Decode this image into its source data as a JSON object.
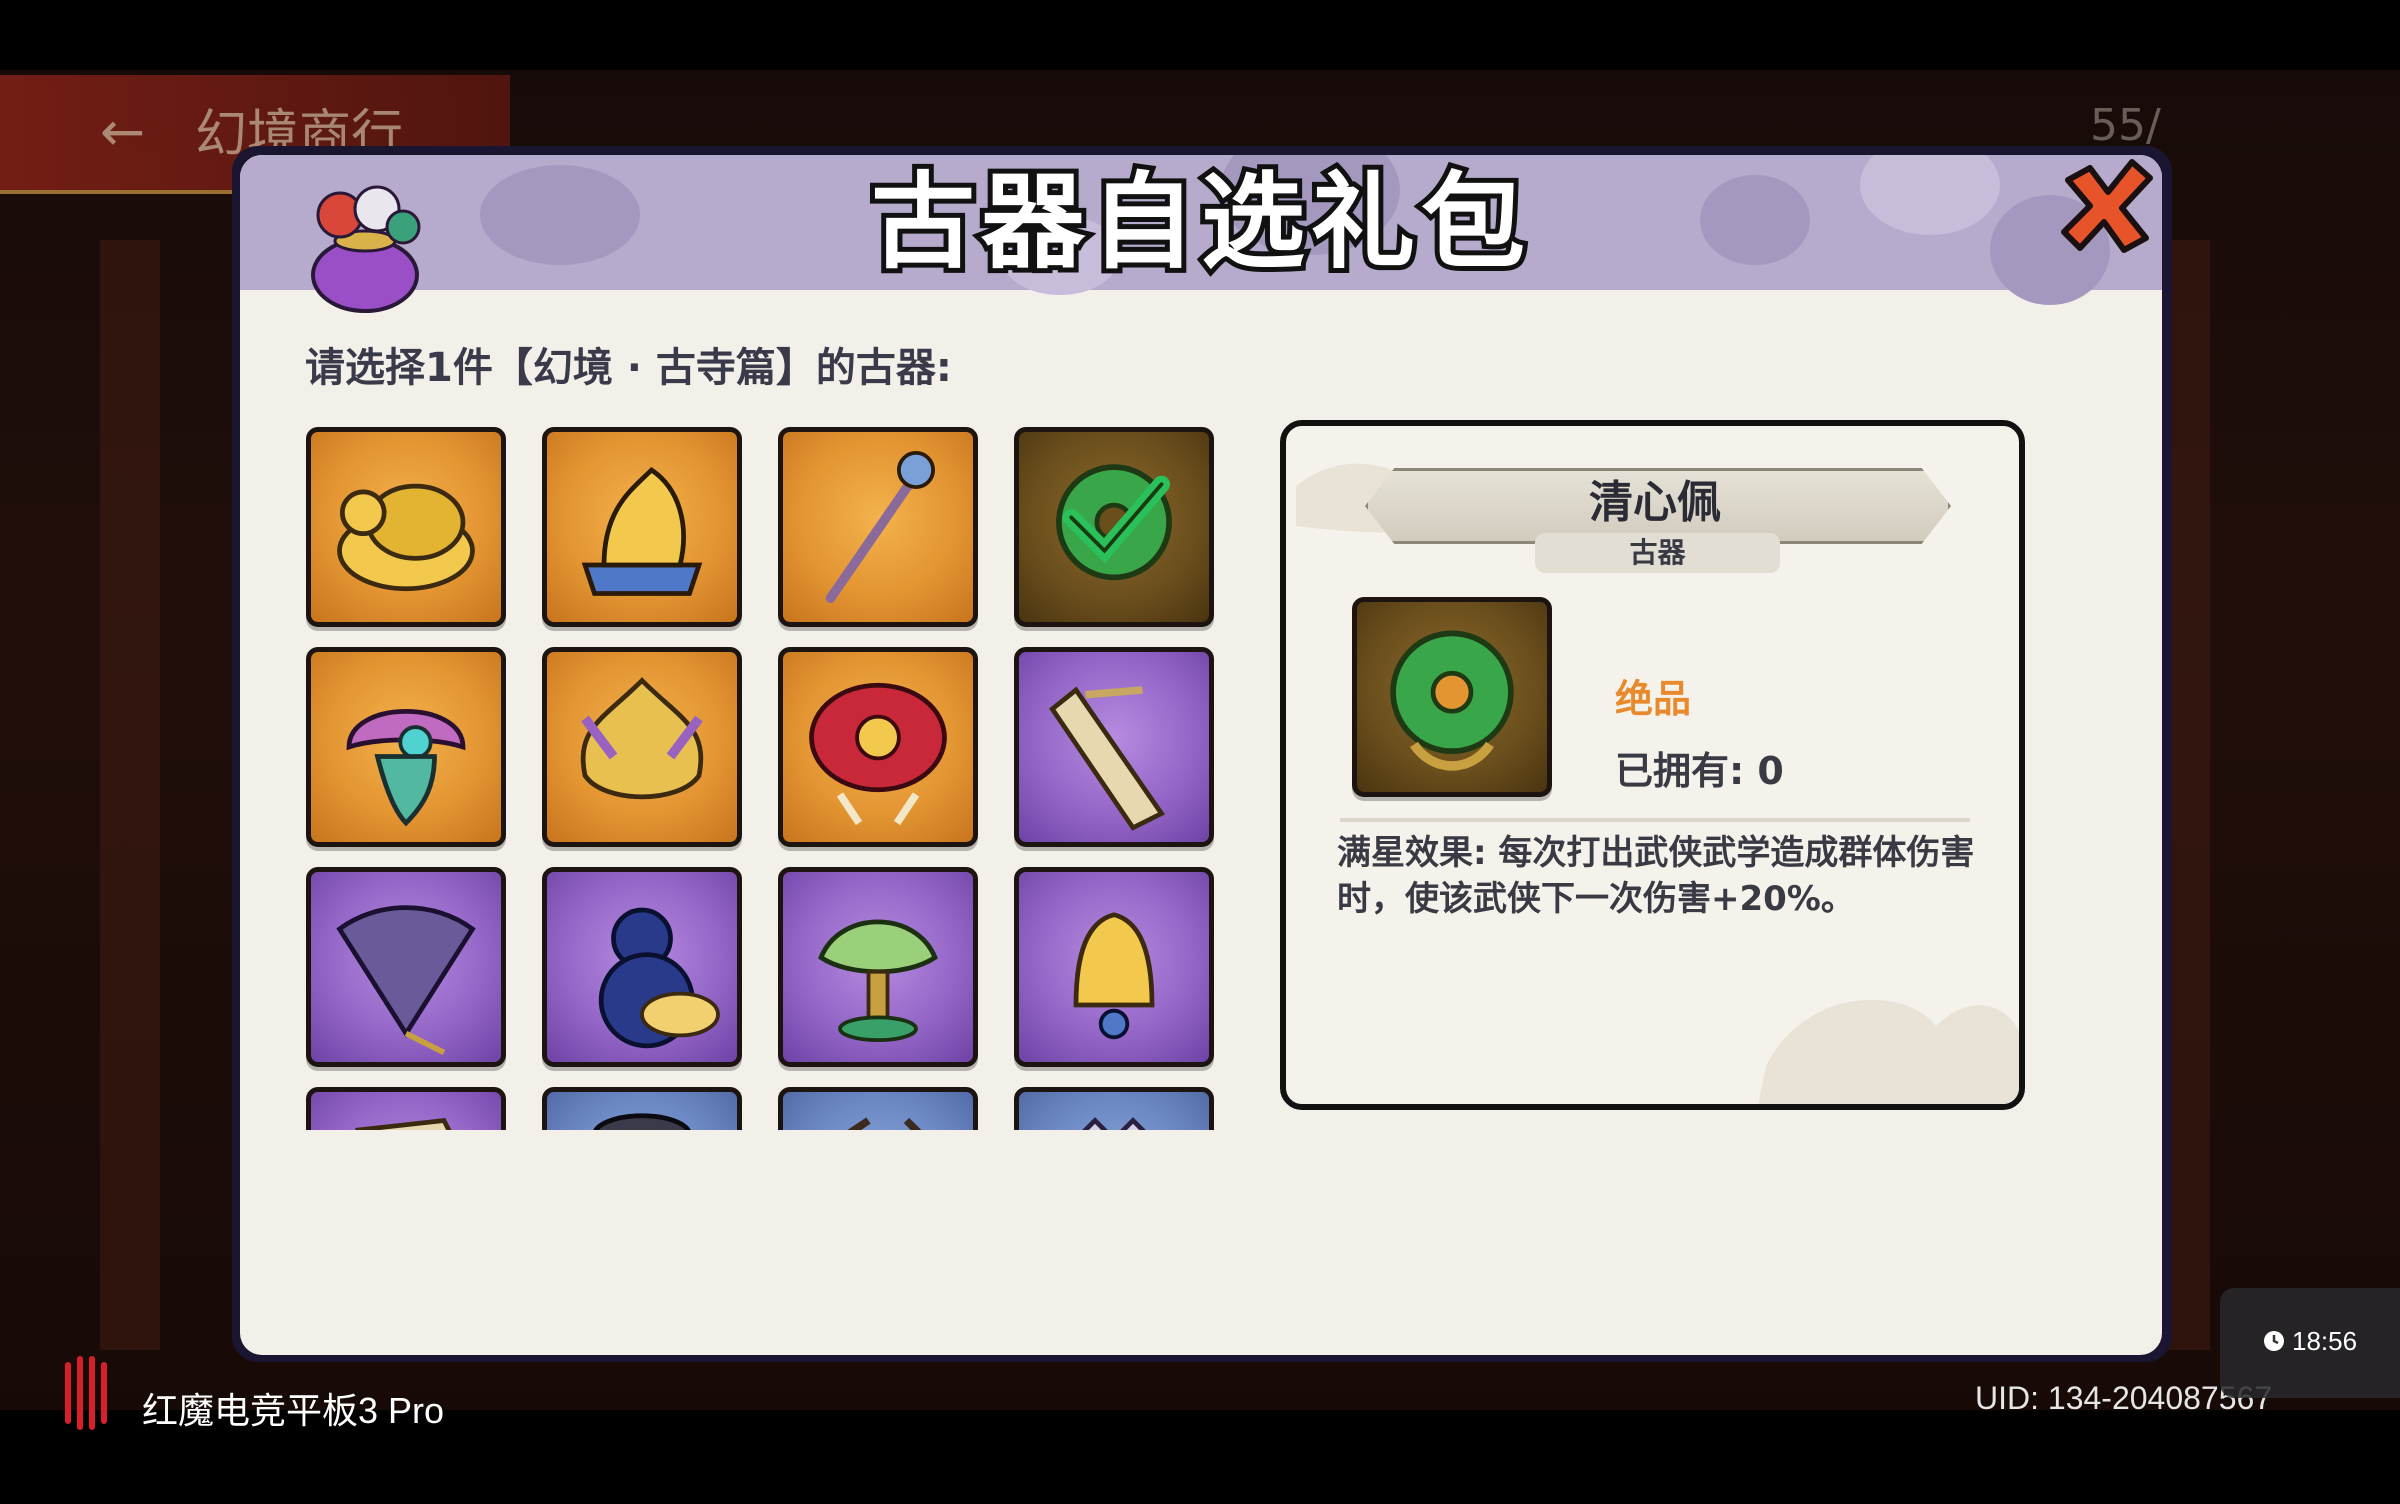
{
  "background": {
    "shop_title": "幻境商行",
    "energy": "55/"
  },
  "modal": {
    "title": "古器自选礼包",
    "prompt": "请选择1件【幻境 · 古寺篇】的古器:"
  },
  "grid": {
    "items": [
      {
        "icon": "golden-turtle-icon",
        "frame": "orange"
      },
      {
        "icon": "golden-dragon-seal-icon",
        "frame": "orange"
      },
      {
        "icon": "dragon-staff-icon",
        "frame": "orange"
      },
      {
        "icon": "jade-pendant-icon",
        "frame": "brown",
        "selected": true
      },
      {
        "icon": "pearl-shell-icon",
        "frame": "orange"
      },
      {
        "icon": "phoenix-crest-icon",
        "frame": "orange"
      },
      {
        "icon": "red-parasol-icon",
        "frame": "orange"
      },
      {
        "icon": "guqin-icon",
        "frame": "purple"
      },
      {
        "icon": "folding-fan-icon",
        "frame": "purple"
      },
      {
        "icon": "gourd-icon",
        "frame": "purple"
      },
      {
        "icon": "lotus-lamp-icon",
        "frame": "purple"
      },
      {
        "icon": "golden-bell-icon",
        "frame": "purple"
      },
      {
        "icon": "scroll-icon",
        "frame": "purple"
      },
      {
        "icon": "ink-stone-icon",
        "frame": "blue"
      },
      {
        "icon": "brush-icon",
        "frame": "blue"
      },
      {
        "icon": "crown-icon",
        "frame": "blue"
      }
    ]
  },
  "detail": {
    "name": "清心佩",
    "type": "古器",
    "rarity": "绝品",
    "owned": "已拥有: 0",
    "effect": "满星效果: 每次打出武侠武学造成群体伤害时，使该武侠下一次伤害+20%。",
    "icon": "jade-pendant-icon"
  },
  "device": {
    "name": "红魔电竞平板3 Pro",
    "uid": "UID:  134-204087567",
    "time": "18:56"
  },
  "colors": {
    "rarity": "#e88a2c",
    "header": "#b6abcc",
    "close": "#e8542a"
  }
}
